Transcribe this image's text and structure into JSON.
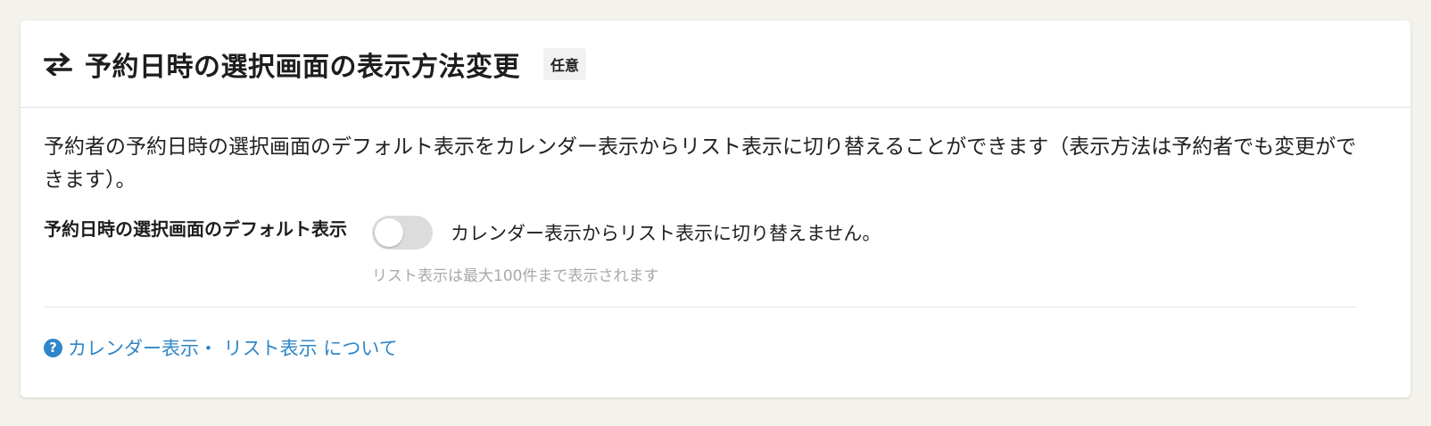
{
  "section": {
    "title": "予約日時の選択画面の表示方法変更",
    "badge": "任意",
    "icon": "swap-arrows-icon",
    "description": "予約者の予約日時の選択画面のデフォルト表示をカレンダー表示からリスト表示に切り替えることができます（表示方法は予約者でも変更ができます）。"
  },
  "setting": {
    "label": "予約日時の選択画面のデフォルト表示",
    "toggle_on": false,
    "toggle_text": "カレンダー表示からリスト表示に切り替えません。",
    "hint": "リスト表示は最大100件まで表示されます"
  },
  "help": {
    "icon_glyph": "?",
    "link_text": "カレンダー表示・ リスト表示 について"
  },
  "colors": {
    "accent": "#2f86c8",
    "toggle_off": "#dcdcdc",
    "background": "#f4f2ec"
  }
}
